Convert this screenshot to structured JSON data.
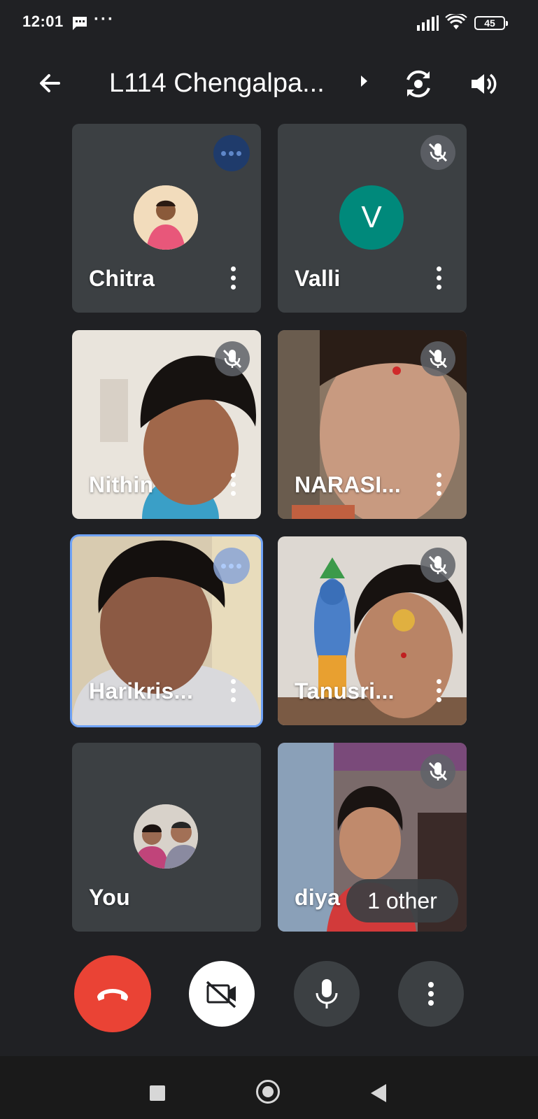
{
  "status_bar": {
    "time": "12:01",
    "battery": "45",
    "icons": [
      "message-icon",
      "more-dots-icon",
      "signal-icon",
      "wifi-icon",
      "battery-icon"
    ]
  },
  "header": {
    "title": "L114 Chengalpa...",
    "icons": [
      "back-arrow-icon",
      "chevron-right-icon",
      "switch-camera-icon",
      "speaker-icon"
    ]
  },
  "participants": [
    {
      "name": "Chitra",
      "state": "speaking"
    },
    {
      "name": "Valli",
      "initial": "V",
      "avatar_color": "#00897b",
      "state": "muted"
    },
    {
      "name": "Nithin",
      "state": "muted"
    },
    {
      "name": "NARASI...",
      "state": "muted"
    },
    {
      "name": "Harikris...",
      "state": "speaking",
      "selected": true
    },
    {
      "name": "Tanusri...",
      "state": "muted"
    },
    {
      "name": "You",
      "state": "self"
    },
    {
      "name": "diya",
      "state": "muted"
    }
  ],
  "other_badge": "1 other",
  "controls": {
    "end_call_color": "#ea4335",
    "icons": [
      "end-call-icon",
      "camera-off-icon",
      "microphone-icon",
      "more-options-icon"
    ]
  },
  "colors": {
    "background": "#202124",
    "tile": "#3c4043",
    "highlight": "#6fa2f5"
  }
}
